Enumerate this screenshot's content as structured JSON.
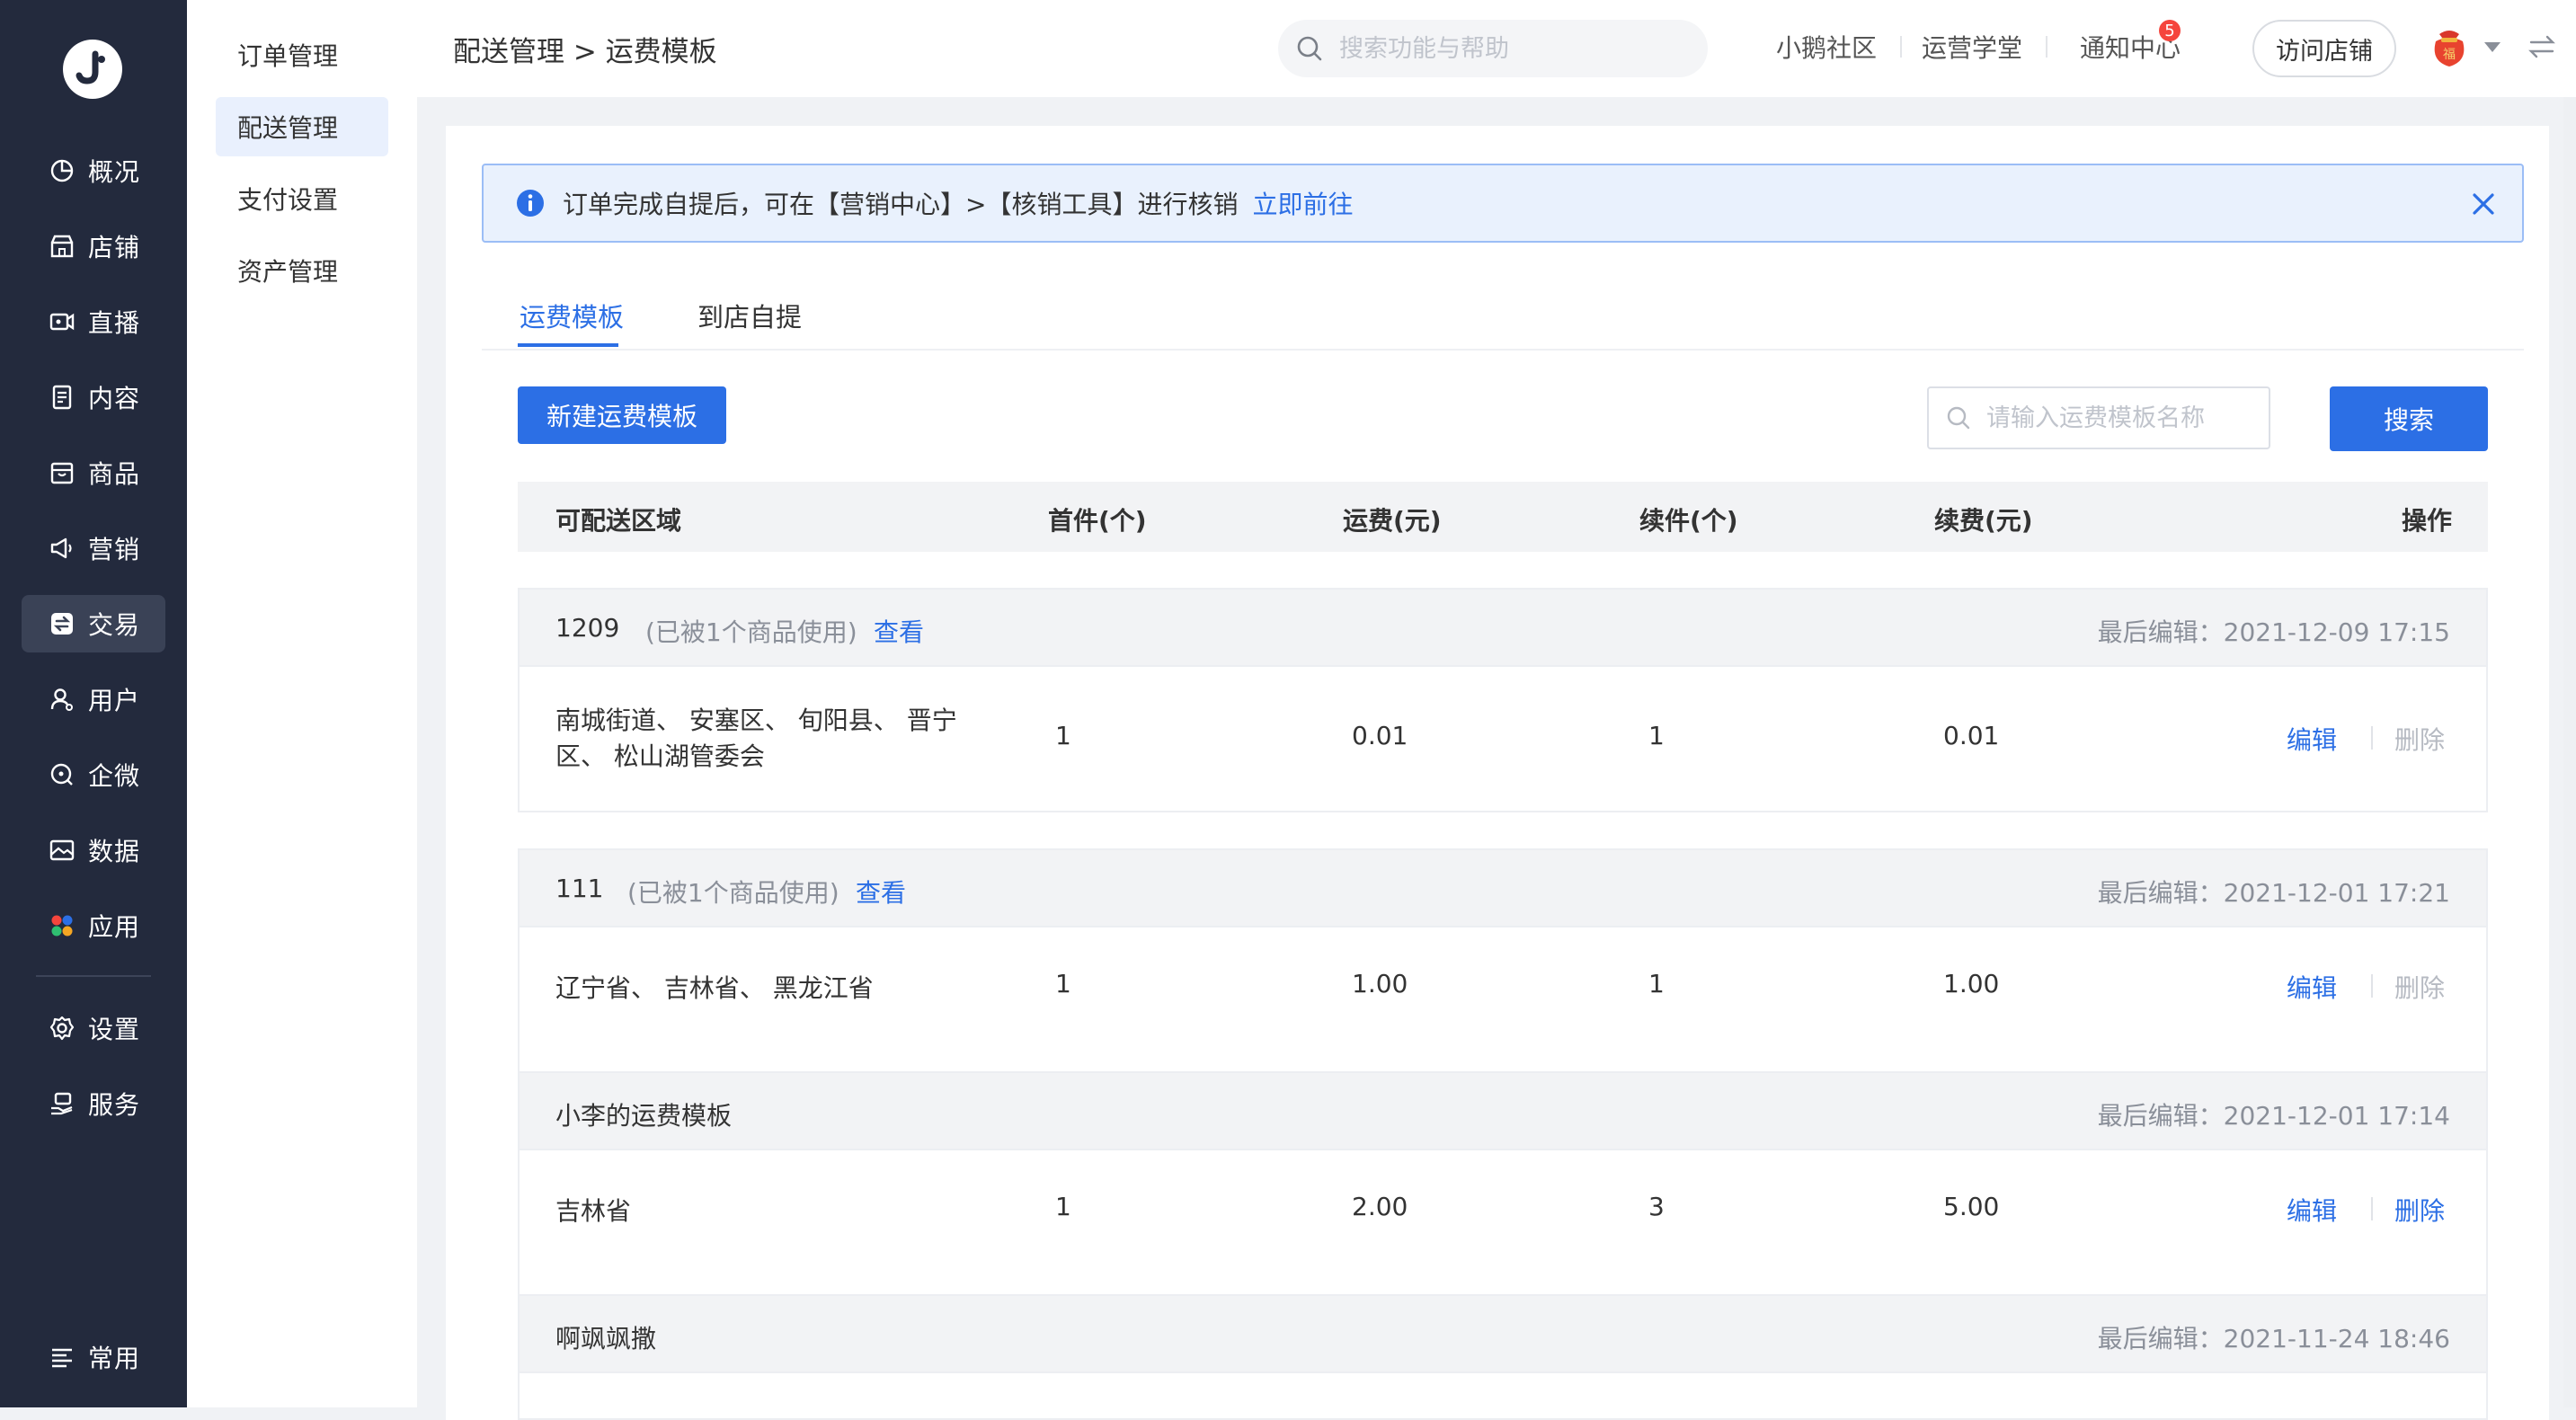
{
  "nav": {
    "items": [
      {
        "label": "概况",
        "icon": "pie-chart-icon"
      },
      {
        "label": "店铺",
        "icon": "store-icon"
      },
      {
        "label": "直播",
        "icon": "live-camera-icon"
      },
      {
        "label": "内容",
        "icon": "document-icon"
      },
      {
        "label": "商品",
        "icon": "box-icon"
      },
      {
        "label": "营销",
        "icon": "megaphone-icon"
      },
      {
        "label": "交易",
        "icon": "exchange-icon",
        "active": true
      },
      {
        "label": "用户",
        "icon": "user-icon"
      },
      {
        "label": "企微",
        "icon": "chat-bubble-icon"
      },
      {
        "label": "数据",
        "icon": "image-chart-icon"
      },
      {
        "label": "应用",
        "icon": "apps-icon"
      }
    ],
    "bottom_items": [
      {
        "label": "设置",
        "icon": "gear-icon"
      },
      {
        "label": "服务",
        "icon": "service-hand-icon"
      }
    ],
    "footer": {
      "label": "常用",
      "icon": "list-icon"
    }
  },
  "submenu": {
    "items": [
      {
        "label": "订单管理"
      },
      {
        "label": "配送管理",
        "active": true
      },
      {
        "label": "支付设置"
      },
      {
        "label": "资产管理"
      }
    ]
  },
  "header": {
    "breadcrumb": "配送管理 > 运费模板",
    "search_placeholder": "搜索功能与帮助",
    "links": [
      "小鹅社区",
      "运营学堂",
      "通知中心"
    ],
    "notification_count": "5",
    "visit_store": "访问店铺",
    "avatar_text": "福"
  },
  "notice": {
    "text": "订单完成自提后，可在【营销中心】>【核销工具】进行核销",
    "link": "立即前往"
  },
  "tabs": [
    {
      "label": "运费模板",
      "active": true
    },
    {
      "label": "到店自提"
    }
  ],
  "toolbar": {
    "new_template": "新建运费模板",
    "search_placeholder": "请输入运费模板名称",
    "search_button": "搜索"
  },
  "table": {
    "columns": [
      "可配送区域",
      "首件(个)",
      "运费(元)",
      "续件(个)",
      "续费(元)",
      "操作"
    ],
    "edit_label": "编辑",
    "delete_label": "删除",
    "groups": [
      {
        "name": "1209",
        "used": "(已被1个商品使用)",
        "view": "查看",
        "last_edit": "最后编辑：2021-12-09 17:15",
        "area": "南城街道、 安塞区、 旬阳县、 晋宁区、 松山湖管委会",
        "first": "1",
        "fee": "0.01",
        "extra": "1",
        "extra_fee": "0.01",
        "deletable": false
      },
      {
        "name": "111",
        "used": "(已被1个商品使用)",
        "view": "查看",
        "last_edit": "最后编辑：2021-12-01 17:21",
        "area": "辽宁省、 吉林省、 黑龙江省",
        "first": "1",
        "fee": "1.00",
        "extra": "1",
        "extra_fee": "1.00",
        "deletable": false
      },
      {
        "name": "小李的运费模板",
        "last_edit": "最后编辑：2021-12-01 17:14",
        "area": "吉林省",
        "first": "1",
        "fee": "2.00",
        "extra": "3",
        "extra_fee": "5.00",
        "deletable": true
      },
      {
        "name": "啊飒飒撒",
        "last_edit": "最后编辑：2021-11-24 18:46"
      }
    ]
  },
  "colors": {
    "nav_bg": "#232a3d",
    "accent": "#2c6fe5",
    "notice_bg": "#e9f1fd",
    "badge": "#f5453d"
  }
}
